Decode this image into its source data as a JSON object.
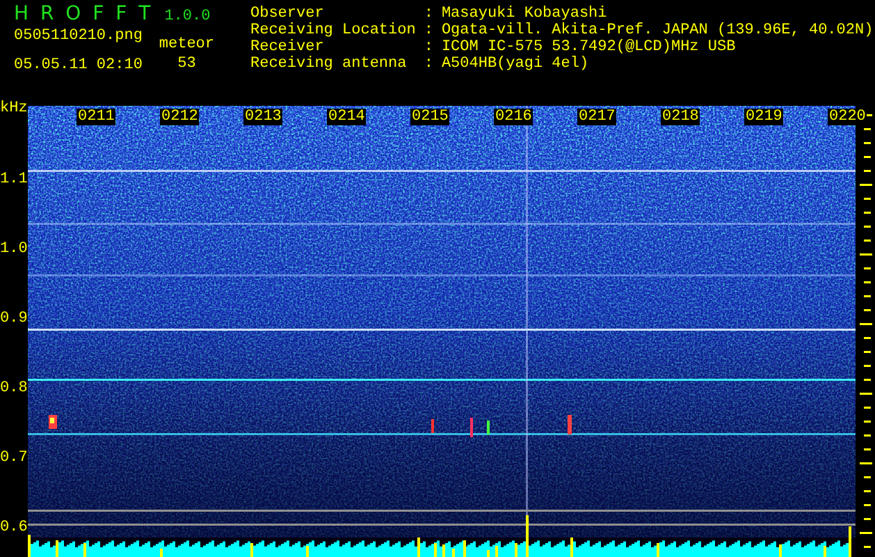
{
  "app": {
    "title": "H R O F F T",
    "version": "1.0.0",
    "filename": "0505110210.png",
    "datetime": "05.05.11 02:10",
    "meteor_label": "meteor",
    "meteor_count": "53"
  },
  "info": [
    {
      "label": "Observer",
      "separator": ":",
      "value": "Masayuki Kobayashi"
    },
    {
      "label": "Receiving Location",
      "separator": ":",
      "value": "Ogata-vill. Akita-Pref. JAPAN (139.96E, 40.02N)"
    },
    {
      "label": "Receiver",
      "separator": ":",
      "value": "ICOM IC-575 53.7492(@LCD)MHz USB"
    },
    {
      "label": "Receiving antenna",
      "separator": ":",
      "value": "A504HB(yagi 4el)"
    }
  ],
  "spectrogram": {
    "unit": "kHz",
    "freq_labels": [
      "1.1",
      "1.0",
      "0.9",
      "0.8",
      "0.7",
      "0.6"
    ],
    "time_labels": [
      "0211",
      "0212",
      "0213",
      "0214",
      "0215",
      "0216",
      "0217",
      "0218",
      "0219",
      "0220"
    ]
  }
}
